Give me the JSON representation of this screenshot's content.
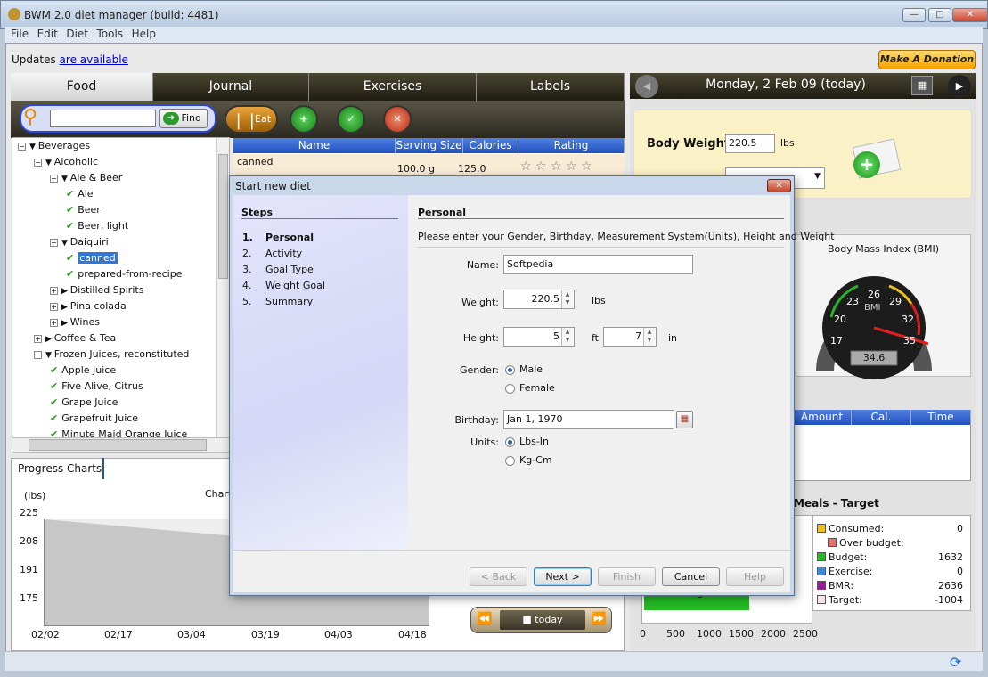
{
  "app": {
    "title": "BWM 2.0 diet manager (build: 4481)"
  },
  "menu": [
    "File",
    "Edit",
    "Diet",
    "Tools",
    "Help"
  ],
  "updates": {
    "prefix": "Updates",
    "link": "are available"
  },
  "donate_label": "Make A Donation",
  "left_tabs": [
    "Food",
    "Journal",
    "Exercises",
    "Labels"
  ],
  "search": {
    "value": "",
    "find_label": "Find"
  },
  "eat_label": "Eat",
  "tree": [
    {
      "label": "Beverages",
      "level": 0,
      "kind": "open"
    },
    {
      "label": "Alcoholic",
      "level": 1,
      "kind": "open"
    },
    {
      "label": "Ale & Beer",
      "level": 2,
      "kind": "open"
    },
    {
      "label": "Ale",
      "level": 3,
      "kind": "check"
    },
    {
      "label": "Beer",
      "level": 3,
      "kind": "check"
    },
    {
      "label": "Beer, light",
      "level": 3,
      "kind": "check"
    },
    {
      "label": "Daiquiri",
      "level": 2,
      "kind": "open"
    },
    {
      "label": "canned",
      "level": 3,
      "kind": "check",
      "selected": true
    },
    {
      "label": "prepared-from-recipe",
      "level": 3,
      "kind": "check"
    },
    {
      "label": "Distilled Spirits",
      "level": 2,
      "kind": "closed"
    },
    {
      "label": "Pina colada",
      "level": 2,
      "kind": "closed"
    },
    {
      "label": "Wines",
      "level": 2,
      "kind": "closed"
    },
    {
      "label": "Coffee & Tea",
      "level": 1,
      "kind": "closed"
    },
    {
      "label": "Frozen Juices, reconstituted",
      "level": 1,
      "kind": "open"
    },
    {
      "label": "Apple Juice",
      "level": 2,
      "kind": "check"
    },
    {
      "label": "Five Alive, Citrus",
      "level": 2,
      "kind": "check"
    },
    {
      "label": "Grape Juice",
      "level": 2,
      "kind": "check"
    },
    {
      "label": "Grapefruit Juice",
      "level": 2,
      "kind": "check"
    },
    {
      "label": "Minute Maid Orange Juice",
      "level": 2,
      "kind": "check"
    }
  ],
  "food_grid": {
    "columns": [
      "Name",
      "Serving Size",
      "Calories",
      "Rating"
    ],
    "rows": [
      {
        "name": "canned",
        "serving": "100.0 g",
        "calories": "125.0",
        "rating": "☆ ☆ ☆ ☆ ☆"
      }
    ]
  },
  "progress": {
    "tab_label": "Progress Charts",
    "unit": "(lbs)",
    "charts_label": "Charts",
    "y_ticks": [
      "225",
      "208",
      "191",
      "175"
    ],
    "x_ticks": [
      "02/02",
      "02/17",
      "03/04",
      "03/19",
      "04/03",
      "04/18"
    ]
  },
  "today_label": "today",
  "right": {
    "date": "Monday, 2 Feb 09 (today)",
    "body_weight_label": "Body Weight:",
    "body_weight_value": "220.5",
    "body_weight_unit": "lbs",
    "bmi_title": "Body Mass Index (BMI)",
    "bmi_value": "34.6",
    "bmi_label": "BMI",
    "gauge_ticks": [
      "17",
      "20",
      "23",
      "26",
      "29",
      "32",
      "35"
    ],
    "meal_columns": [
      "Amount",
      "Cal.",
      "Time"
    ],
    "meals_title": "Meals - Target",
    "budget_label": "Budget",
    "bar_axis": [
      "0",
      "500",
      "1000",
      "1500",
      "2000",
      "2500"
    ],
    "legend": [
      {
        "label": "Consumed:",
        "value": "0",
        "color": "#f0c020"
      },
      {
        "label": "Over budget:",
        "value": "",
        "color": "#e07070",
        "indent": true
      },
      {
        "label": "Budget:",
        "value": "1632",
        "color": "#22bb22"
      },
      {
        "label": "Exercise:",
        "value": "0",
        "color": "#3a8ae0"
      },
      {
        "label": "BMR:",
        "value": "2636",
        "color": "#9a1a9a"
      },
      {
        "label": "Target:",
        "value": "-1004",
        "color": "#f4e4e4"
      }
    ]
  },
  "dialog": {
    "title": "Start new diet",
    "steps_title": "Steps",
    "steps": [
      {
        "num": "1.",
        "label": "Personal",
        "active": true
      },
      {
        "num": "2.",
        "label": "Activity"
      },
      {
        "num": "3.",
        "label": "Goal Type"
      },
      {
        "num": "4.",
        "label": "Weight Goal"
      },
      {
        "num": "5.",
        "label": "Summary"
      }
    ],
    "section_title": "Personal",
    "description": "Please enter your Gender, Birthday, Measurement  System(Units), Height and Weight",
    "name_label": "Name:",
    "name_value": "Softpedia",
    "weight_label": "Weight:",
    "weight_value": "220.5",
    "weight_unit": "lbs",
    "height_label": "Height:",
    "height_ft": "5",
    "height_ft_unit": "ft",
    "height_in": "7",
    "height_in_unit": "in",
    "gender_label": "Gender:",
    "gender_options": [
      "Male",
      "Female"
    ],
    "gender_selected": "Male",
    "birthday_label": "Birthday:",
    "birthday_value": "Jan 1, 1970",
    "units_label": "Units:",
    "units_options": [
      "Lbs-In",
      "Kg-Cm"
    ],
    "units_selected": "Lbs-In",
    "buttons": {
      "back": "< Back",
      "next": "Next >",
      "finish": "Finish",
      "cancel": "Cancel",
      "help": "Help"
    }
  }
}
